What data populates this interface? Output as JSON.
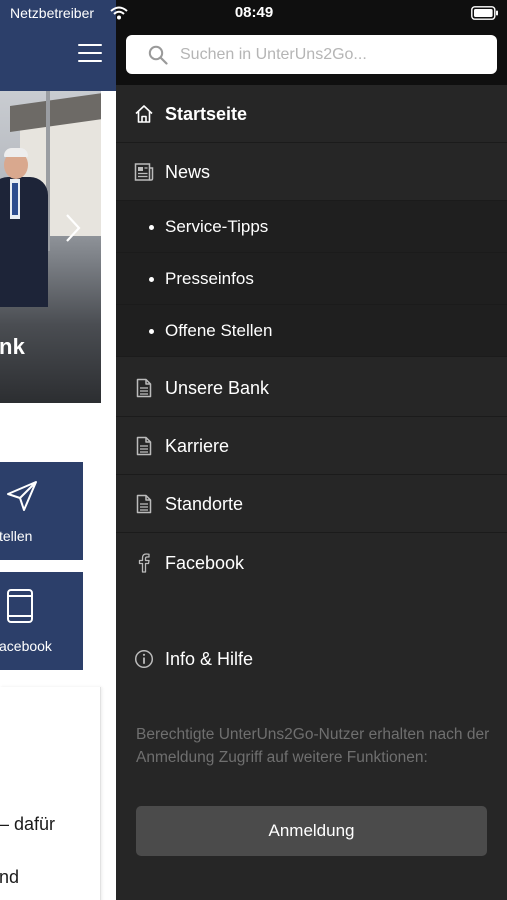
{
  "status_bar": {
    "carrier": "Netzbetreiber",
    "time": "08:49"
  },
  "background_page": {
    "hero_caption": "nk",
    "tiles": [
      {
        "label": "tellen",
        "icon": "paper-plane-icon"
      },
      {
        "label": "acebook",
        "icon": "tablet-icon"
      }
    ],
    "text_fragments": [
      "– dafür",
      "nd"
    ],
    "colors": {
      "header": "#2c3f6a",
      "tile": "#2c3f6a"
    }
  },
  "drawer": {
    "search": {
      "placeholder": "Suchen in UnterUns2Go..."
    },
    "items": [
      {
        "label": "Startseite",
        "icon": "home-icon",
        "active": true
      },
      {
        "label": "News",
        "icon": "newspaper-icon"
      },
      {
        "label": "Service-Tipps",
        "sub": true
      },
      {
        "label": "Presseinfos",
        "sub": true
      },
      {
        "label": "Offene Stellen",
        "sub": true
      },
      {
        "label": "Unsere Bank",
        "icon": "document-icon"
      },
      {
        "label": "Karriere",
        "icon": "document-icon"
      },
      {
        "label": "Standorte",
        "icon": "document-icon"
      },
      {
        "label": "Facebook",
        "icon": "facebook-icon"
      },
      {
        "label": "Info & Hilfe",
        "icon": "info-icon"
      }
    ],
    "note": "Berechtigte UnterUns2Go-Nutzer erhalten nach der Anmeldung Zugriff auf weitere Funktionen:",
    "login_label": "Anmeldung",
    "colors": {
      "background": "#262626",
      "submenu": "#1f1f1f",
      "button": "#4b4b4b"
    }
  }
}
